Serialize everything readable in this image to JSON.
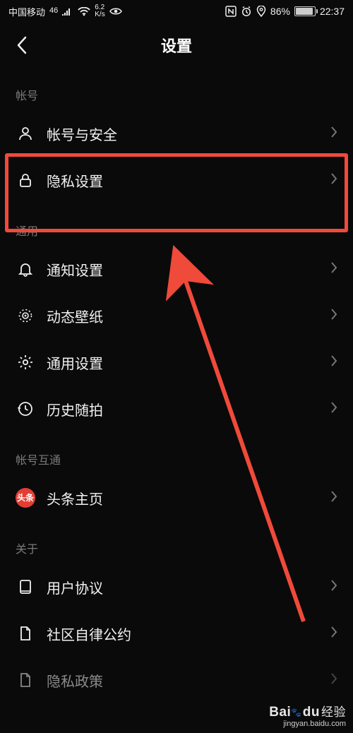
{
  "status": {
    "carrier": "中国移动",
    "network_tag": "46",
    "speed_top": "6.2",
    "speed_bot": "K/s",
    "battery_pct": "86%",
    "time": "22:37"
  },
  "header": {
    "title": "设置"
  },
  "sections": {
    "account": {
      "header": "帐号",
      "items": {
        "security": "帐号与安全",
        "privacy": "隐私设置"
      }
    },
    "general": {
      "header": "通用",
      "items": {
        "notifications": "通知设置",
        "wallpaper": "动态壁纸",
        "general_settings": "通用设置",
        "history_shoot": "历史随拍"
      }
    },
    "link": {
      "header": "帐号互通",
      "items": {
        "toutiao": "头条主页",
        "toutiao_badge": "头条"
      }
    },
    "about": {
      "header": "关于",
      "items": {
        "user_agreement": "用户协议",
        "community_rules": "社区自律公约",
        "privacy_policy": "隐私政策"
      }
    }
  },
  "watermark": {
    "brand": "Bai",
    "brand2": "du",
    "suffix": "经验",
    "url": "jingyan.baidu.com"
  }
}
